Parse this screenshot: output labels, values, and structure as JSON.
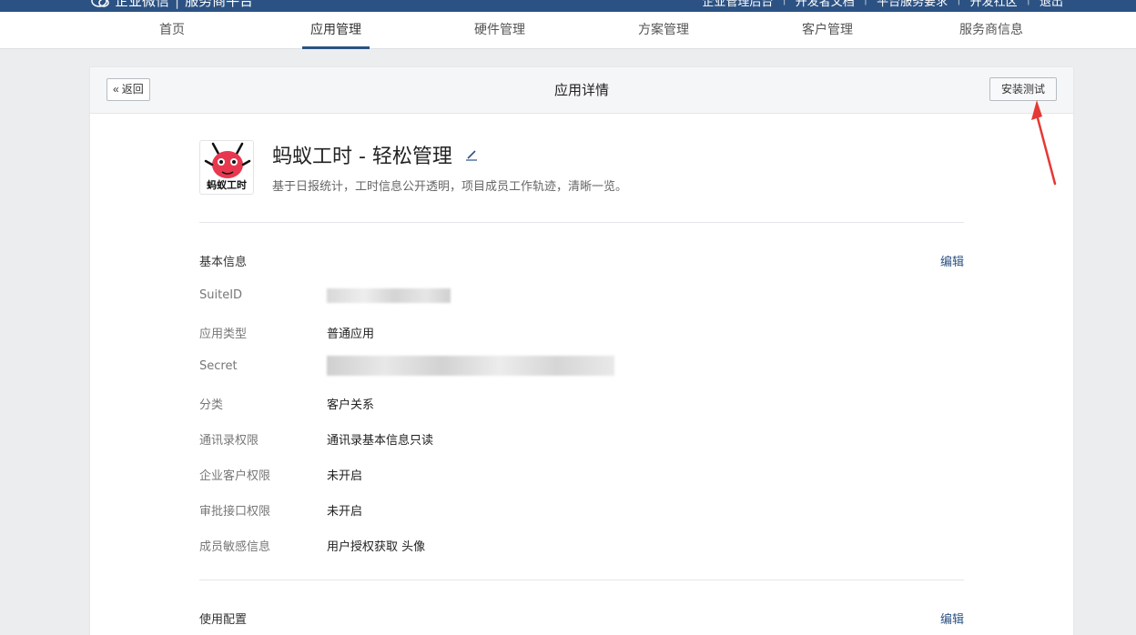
{
  "header": {
    "brand": "企业微信",
    "platform": "服务商平台",
    "links": [
      "企业管理后台",
      "开发者文档",
      "平台服务要求",
      "开发社区",
      "退出"
    ]
  },
  "nav": {
    "tabs": [
      "首页",
      "应用管理",
      "硬件管理",
      "方案管理",
      "客户管理",
      "服务商信息"
    ],
    "active": "应用管理"
  },
  "page": {
    "back_label": "返回",
    "title": "应用详情",
    "install_label": "安装测试"
  },
  "app": {
    "icon_text": "蚂蚁工时",
    "name": "蚂蚁工时 - 轻松管理",
    "description": "基于日报统计，工时信息公开透明，项目成员工作轨迹，清晰一览。"
  },
  "basic_info": {
    "title": "基本信息",
    "edit_label": "编辑",
    "rows": [
      {
        "label": "SuiteID",
        "value": ""
      },
      {
        "label": "应用类型",
        "value": "普通应用"
      },
      {
        "label": "Secret",
        "value": ""
      },
      {
        "label": "分类",
        "value": "客户关系"
      },
      {
        "label": "通讯录权限",
        "value": "通讯录基本信息只读"
      },
      {
        "label": "企业客户权限",
        "value": "未开启"
      },
      {
        "label": "审批接口权限",
        "value": "未开启"
      },
      {
        "label": "成员敏感信息",
        "value": "用户授权获取 头像"
      }
    ]
  },
  "usage_config": {
    "title": "使用配置",
    "edit_label": "编辑"
  },
  "colors": {
    "brand_blue": "#2c5283",
    "annotation_red": "#e53935",
    "ant_red": "#e8384f"
  }
}
